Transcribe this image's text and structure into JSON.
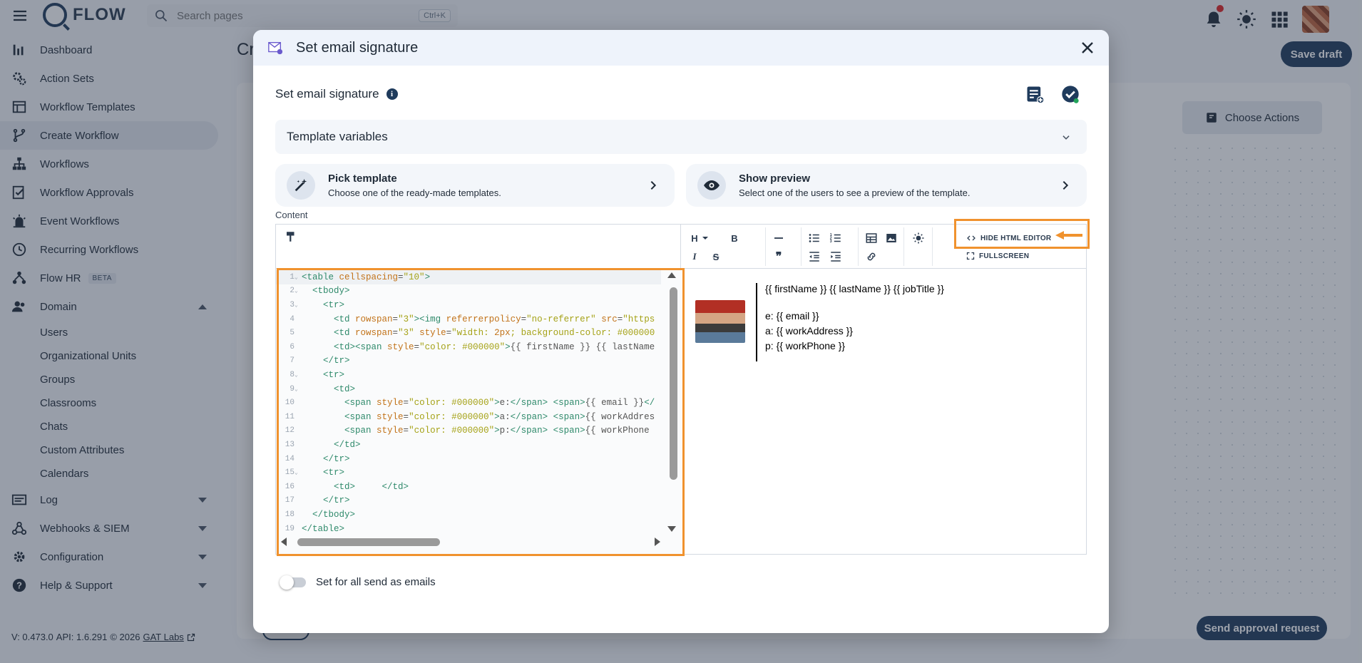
{
  "app": {
    "name": "FLOW",
    "search_placeholder": "Search pages",
    "search_shortcut": "Ctrl+K",
    "page_title": "Cr",
    "save_draft": "Save draft",
    "choose_actions": "Choose Actions",
    "send_approval": "Send approval request"
  },
  "sidebar": {
    "items": [
      {
        "label": "Dashboard",
        "icon": "chart-bar-icon"
      },
      {
        "label": "Action Sets",
        "icon": "gears-icon"
      },
      {
        "label": "Workflow Templates",
        "icon": "template-icon"
      },
      {
        "label": "Create Workflow",
        "icon": "branch-icon",
        "active": true
      },
      {
        "label": "Workflows",
        "icon": "hierarchy-icon"
      },
      {
        "label": "Workflow Approvals",
        "icon": "approval-icon"
      },
      {
        "label": "Event Workflows",
        "icon": "alarm-icon"
      },
      {
        "label": "Recurring Workflows",
        "icon": "clock-icon"
      },
      {
        "label": "Flow HR",
        "icon": "hr-icon",
        "badge": "BETA"
      },
      {
        "label": "Domain",
        "icon": "users-icon"
      }
    ],
    "domain_sub": [
      "Users",
      "Organizational Units",
      "Groups",
      "Classrooms",
      "Chats",
      "Custom Attributes",
      "Calendars"
    ],
    "bottom_items": [
      {
        "label": "Log",
        "icon": "log-icon"
      },
      {
        "label": "Webhooks & SIEM",
        "icon": "webhook-icon"
      },
      {
        "label": "Configuration",
        "icon": "gear-icon"
      },
      {
        "label": "Help & Support",
        "icon": "help-icon"
      }
    ],
    "version": "V: 0.473.0",
    "api": "API: 1.6.291",
    "copyright": "© 2026",
    "company": "GAT Labs"
  },
  "modal": {
    "title": "Set email signature",
    "section_label": "Set email signature",
    "template_variables": "Template variables",
    "pick_template_title": "Pick template",
    "pick_template_sub": "Choose one of the ready-made templates.",
    "show_preview_title": "Show preview",
    "show_preview_sub": "Select one of the users to see a preview of the template.",
    "content_label": "Content",
    "hide_html_editor": "HIDE HTML EDITOR",
    "fullscreen": "FULLSCREEN",
    "toggle_label": "Set for all send as emails",
    "code_lines": [
      "<table cellspacing=\"10\">",
      "  <tbody>",
      "    <tr>",
      "      <td rowspan=\"3\"><img referrerpolicy=\"no-referrer\" src=\"https",
      "      <td rowspan=\"3\" style=\"width: 2px; background-color: #000000",
      "      <td><span style=\"color: #000000\">{{ firstName }} {{ lastName",
      "    </tr>",
      "    <tr>",
      "      <td>",
      "        <span style=\"color: #000000\">e:</span> <span>{{ email }}</",
      "        <span style=\"color: #000000\">a:</span> <span>{{ workAddres",
      "        <span style=\"color: #000000\">p:</span> <span>{{ workPhone ",
      "      </td>",
      "    </tr>",
      "    <tr>",
      "      <td>     </td>",
      "    </tr>",
      "  </tbody>",
      "</table>"
    ],
    "preview": {
      "name_line": "{{ firstName }} {{ lastName }} {{ jobTitle }}",
      "email_line": "e: {{ email }}",
      "address_line": "a: {{ workAddress }}",
      "phone_line": "p: {{ workPhone }}"
    }
  },
  "colors": {
    "primary": "#1f3b5c",
    "highlight": "#f0922e",
    "notification": "#e02424"
  }
}
